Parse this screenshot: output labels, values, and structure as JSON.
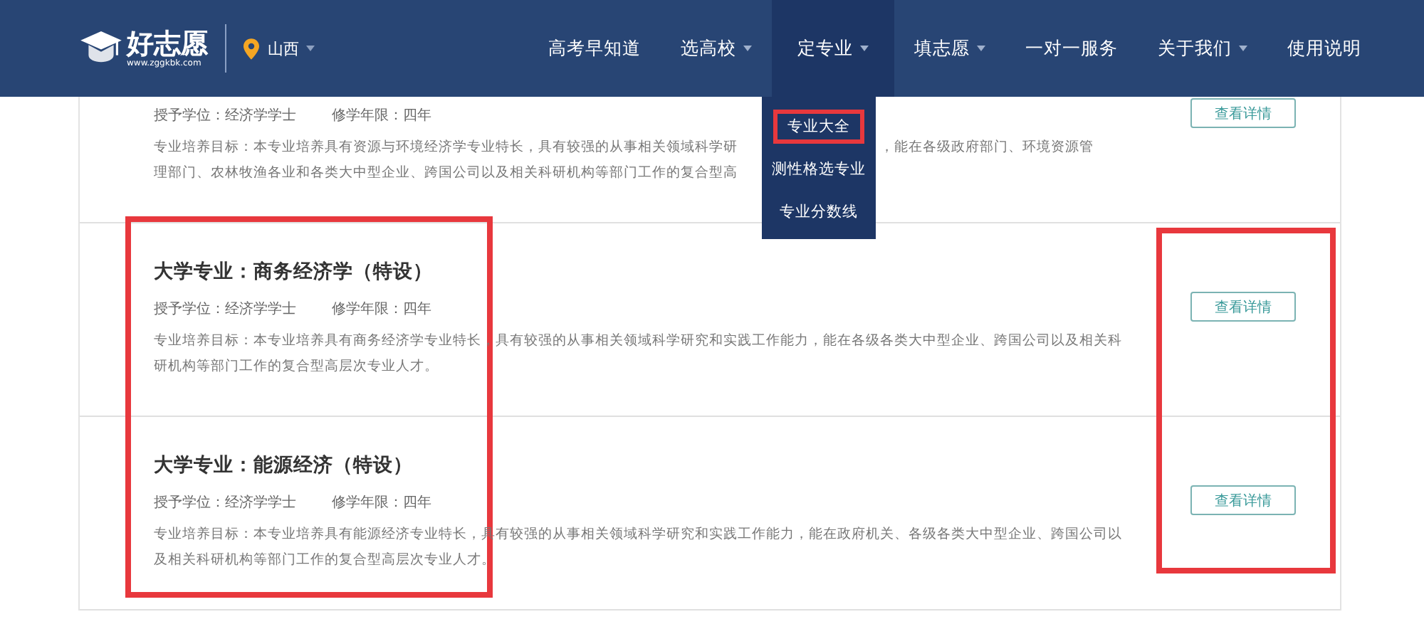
{
  "header": {
    "logo": {
      "name": "好志愿",
      "url": "www.zggkbk.com"
    },
    "location": "山西",
    "nav": [
      {
        "label": "高考早知道",
        "dropdown": false,
        "selected": false
      },
      {
        "label": "选高校",
        "dropdown": true,
        "selected": false
      },
      {
        "label": "定专业",
        "dropdown": true,
        "selected": true
      },
      {
        "label": "填志愿",
        "dropdown": true,
        "selected": false
      },
      {
        "label": "一对一服务",
        "dropdown": false,
        "selected": false
      },
      {
        "label": "关于我们",
        "dropdown": true,
        "selected": false
      },
      {
        "label": "使用说明",
        "dropdown": false,
        "selected": false
      }
    ],
    "dropdown_menu": [
      {
        "label": "专业大全",
        "highlighted": true
      },
      {
        "label": "测性格选专业",
        "highlighted": false
      },
      {
        "label": "专业分数线",
        "highlighted": false
      }
    ]
  },
  "majors": [
    {
      "degree": "授予学位：经济学学士",
      "duration": "修学年限：四年",
      "goal_lines": [
        {
          "left": "专业培养目标：本专业培养具有资源与环境经济学专业特长，具有较强的从事相关领域科学研",
          "right": "，能在各级政府部门、环境资源管"
        },
        {
          "left": "理部门、农林牧渔各业和各类大中型企业、跨国公司以及相关科研机构等部门工作的复合型高"
        }
      ],
      "button": "查看详情"
    },
    {
      "title": "大学专业：商务经济学（特设）",
      "degree": "授予学位：经济学学士",
      "duration": "修学年限：四年",
      "goal": "专业培养目标：本专业培养具有商务经济学专业特长，具有较强的从事相关领域科学研究和实践工作能力，能在各级各类大中型企业、跨国公司以及相关科研机构等部门工作的复合型高层次专业人才。",
      "button": "查看详情"
    },
    {
      "title": "大学专业：能源经济（特设）",
      "degree": "授予学位：经济学学士",
      "duration": "修学年限：四年",
      "goal": "专业培养目标：本专业培养具有能源经济专业特长，具有较强的从事相关领域科学研究和实践工作能力，能在政府机关、各级各类大中型企业、跨国公司以及相关科研机构等部门工作的复合型高层次专业人才。",
      "button": "查看详情"
    }
  ]
}
